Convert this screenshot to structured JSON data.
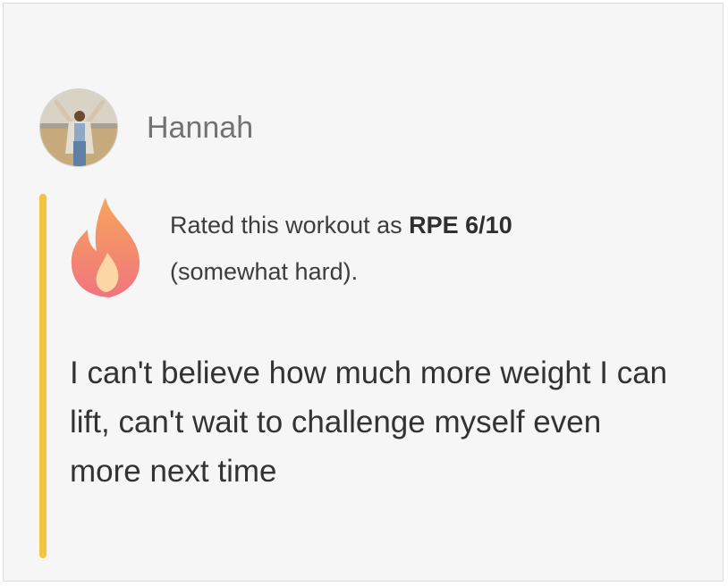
{
  "post": {
    "username": "Hannah",
    "rating": {
      "prefix": "Rated this workout as ",
      "value": "RPE 6/10",
      "description": "(somewhat hard)."
    },
    "comment": "I can't believe how much more weight I can lift, can't wait to challenge myself even more next time"
  },
  "icons": {
    "avatar": "avatar-photo",
    "rating": "flame-icon"
  },
  "colors": {
    "accent_bar": "#f3c43f",
    "flame_top": "#f7a55a",
    "flame_bottom": "#f0757f",
    "flame_inner": "#fbd7a3"
  }
}
